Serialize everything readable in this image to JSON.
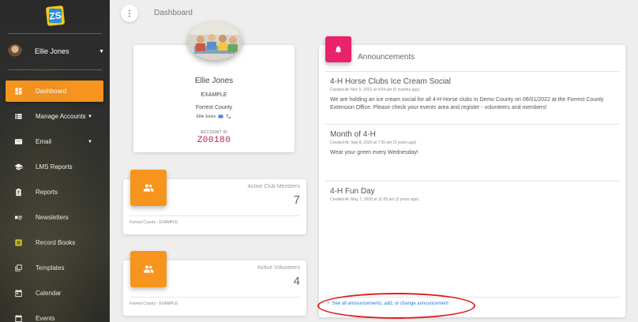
{
  "sidebar": {
    "logo_text": "ZS",
    "user": {
      "name": "Ellie Jones"
    },
    "items": [
      {
        "label": "Dashboard",
        "icon": "dashboard-icon",
        "active": true
      },
      {
        "label": "Manage Accounts",
        "icon": "list-icon",
        "has_caret": true
      },
      {
        "label": "Email",
        "icon": "mail-icon",
        "has_caret": true
      },
      {
        "label": "LMS Reports",
        "icon": "graduation-cap-icon"
      },
      {
        "label": "Reports",
        "icon": "clipboard-icon"
      },
      {
        "label": "Newsletters",
        "icon": "newsletter-icon"
      },
      {
        "label": "Record Books",
        "icon": "record-book-icon"
      },
      {
        "label": "Templates",
        "icon": "templates-icon"
      },
      {
        "label": "Calendar",
        "icon": "calendar-icon"
      },
      {
        "label": "Events",
        "icon": "events-icon"
      }
    ]
  },
  "header": {
    "menu_glyph": "⋮",
    "title": "Dashboard"
  },
  "profile": {
    "name": "Ellie Jones",
    "club": "EXAMPLE",
    "county": "Forrest County",
    "contact_name": "Ellie Jones",
    "account_id_label": "ACCOUNT ID",
    "account_id": "Z00180"
  },
  "stats": [
    {
      "label": "Active Club Members",
      "value": "7",
      "footer": "Forrest County - EXAMPLE"
    },
    {
      "label": "Active Volunteers",
      "value": "4",
      "footer": "Forrest County - EXAMPLE"
    }
  ],
  "announcements": {
    "title": "Announcements",
    "items": [
      {
        "title": "4-H Horse Clubs Ice Cream Social",
        "date": "Created At: Nov 5, 2021 at 9:04 am (5 months ago)",
        "body": "We are holding an ice cream social for all 4-H Horse clubs in Demo County on 06/01/2022 at the Forrest County Extension Office. Please check your events area and register - volunteers and members!"
      },
      {
        "title": "Month of 4-H",
        "date": "Created At: Sep 8, 2020 at 7:30 am (2 years ago)",
        "body": "Wear your green every Wednesday!"
      },
      {
        "title": "4-H Fun Day",
        "date": "Created At: May 7, 2020 at 11:09 am (2 years ago)",
        "body": ""
      }
    ],
    "link_glyph": "+",
    "link_text": "See all announcements, add, or change announcement"
  },
  "colors": {
    "accent": "#f7941d",
    "announce": "#e8226b",
    "account_id": "#c2185b",
    "link": "#2b7bd6",
    "highlight": "#e01e1e"
  }
}
